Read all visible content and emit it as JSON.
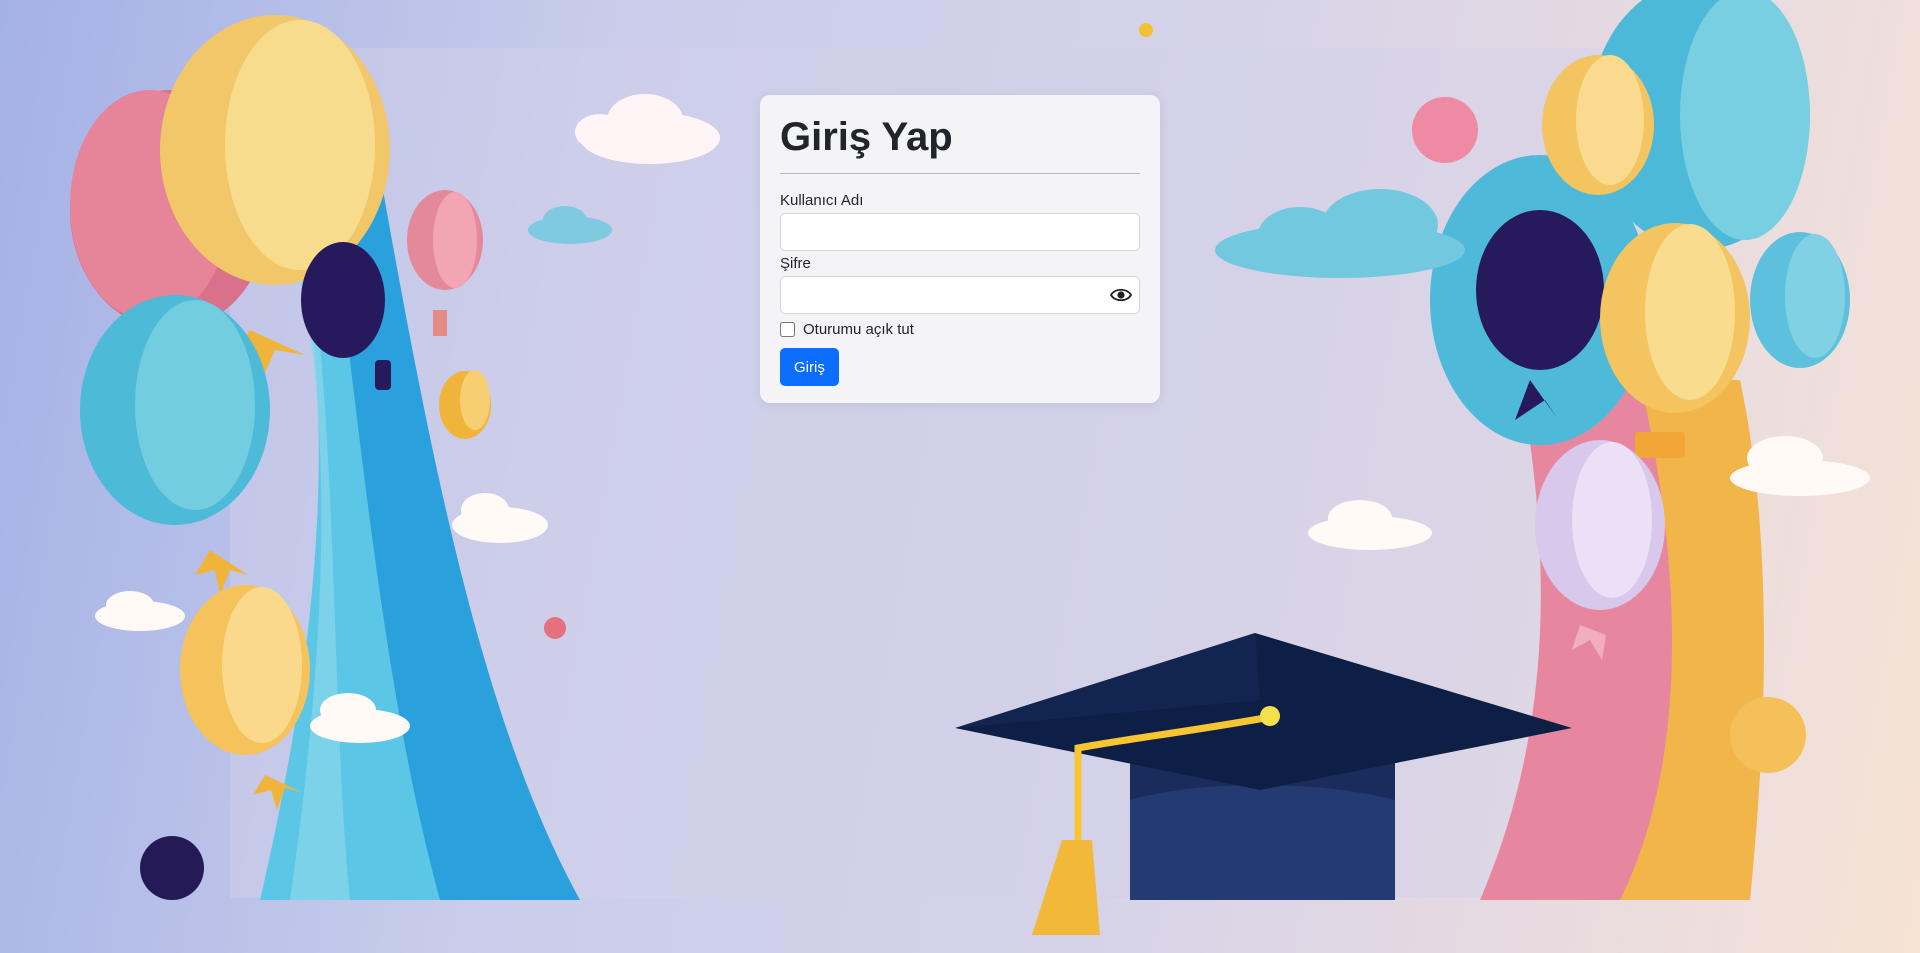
{
  "login": {
    "title": "Giriş Yap",
    "username_label": "Kullanıcı Adı",
    "username_value": "",
    "password_label": "Şifre",
    "password_value": "",
    "show_password_icon": "eye-icon",
    "remember_label": "Oturumu açık tut",
    "remember_checked": false,
    "submit_label": "Giriş",
    "accent_color": "#0d6efd"
  },
  "background": {
    "theme": "graduation balloons illustration",
    "icons": [
      "balloon",
      "cloud",
      "rainbow",
      "graduation-cap"
    ]
  }
}
